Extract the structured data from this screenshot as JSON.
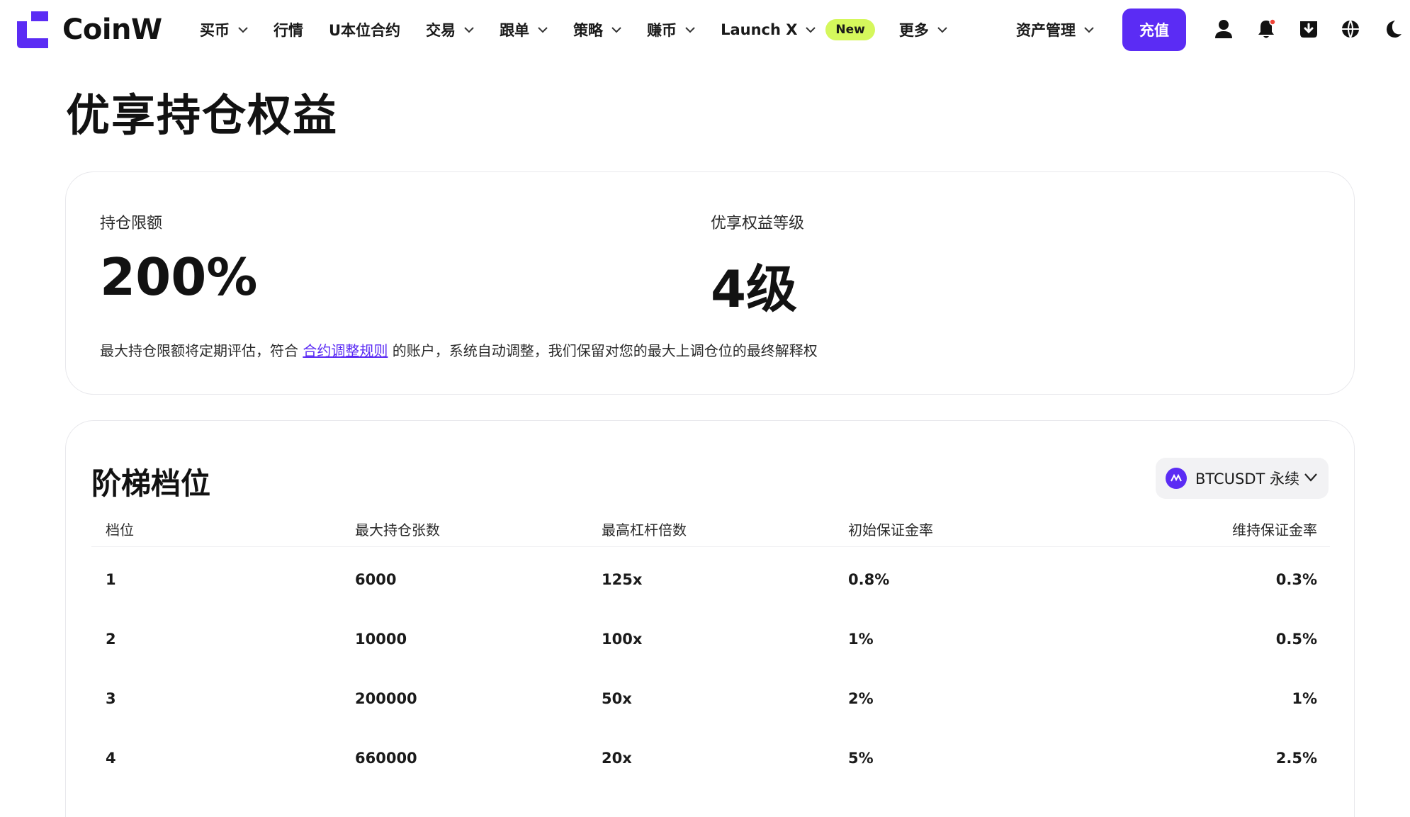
{
  "header": {
    "logo_text": "CoinW",
    "nav": [
      {
        "label": "买币",
        "dropdown": true
      },
      {
        "label": "行情",
        "dropdown": false
      },
      {
        "label": "U本位合约",
        "dropdown": false
      },
      {
        "label": "交易",
        "dropdown": true
      },
      {
        "label": "跟单",
        "dropdown": true
      },
      {
        "label": "策略",
        "dropdown": true
      },
      {
        "label": "赚币",
        "dropdown": true
      },
      {
        "label": "Launch X",
        "dropdown": true,
        "badge": "New"
      },
      {
        "label": "更多",
        "dropdown": true
      }
    ],
    "asset_management": "资产管理",
    "deposit_label": "充值",
    "icons": [
      "user-icon",
      "bell-icon",
      "download-icon",
      "globe-icon",
      "moon-icon"
    ],
    "accent_color": "#5b2cf4",
    "badge_color": "#d5f75c",
    "notification_dot_color": "#f04438"
  },
  "page": {
    "title": "优享持仓权益"
  },
  "summary": {
    "limit_label": "持仓限额",
    "limit_value": "200%",
    "level_label": "优享权益等级",
    "level_value": "4级",
    "note_before": "最大持仓限额将定期评估，符合 ",
    "note_link": "合约调整规则",
    "note_after": " 的账户，系统自动调整，我们保留对您的最大上调仓位的最终解释权"
  },
  "tiers": {
    "title": "阶梯档位",
    "symbol": "BTCUSDT 永续",
    "columns": [
      "档位",
      "最大持仓张数",
      "最高杠杆倍数",
      "初始保证金率",
      "维持保证金率"
    ],
    "rows": [
      [
        "1",
        "6000",
        "125x",
        "0.8%",
        "0.3%"
      ],
      [
        "2",
        "10000",
        "100x",
        "1%",
        "0.5%"
      ],
      [
        "3",
        "200000",
        "50x",
        "2%",
        "1%"
      ],
      [
        "4",
        "660000",
        "20x",
        "5%",
        "2.5%"
      ]
    ]
  }
}
